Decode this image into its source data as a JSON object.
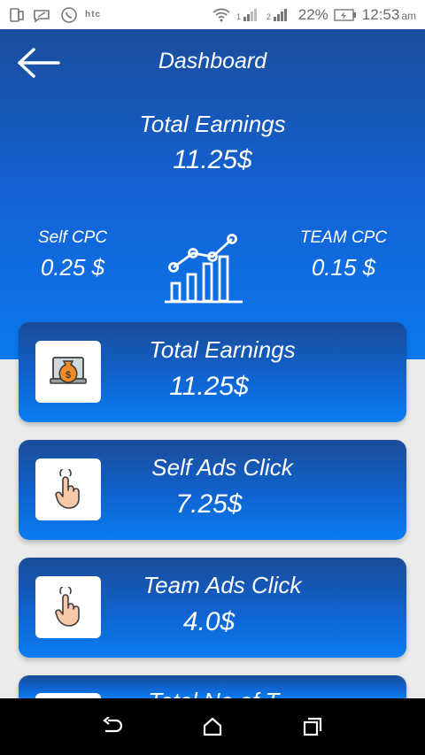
{
  "status_bar": {
    "carrier": "htc",
    "battery_percent": "22%",
    "time": "12:53",
    "time_suffix": "am"
  },
  "header": {
    "title": "Dashboard"
  },
  "summary": {
    "total_label": "Total Earnings",
    "total_value": "11.25$",
    "self_cpc_label": "Self CPC",
    "self_cpc_value": "0.25 $",
    "team_cpc_label": "TEAM CPC",
    "team_cpc_value": "0.15 $"
  },
  "cards": [
    {
      "label": "Total Earnings",
      "value": "11.25$",
      "icon": "money-bag-icon"
    },
    {
      "label": "Self Ads Click",
      "value": "7.25$",
      "icon": "tap-hand-icon"
    },
    {
      "label": "Team Ads Click",
      "value": "4.0$",
      "icon": "tap-hand-icon"
    },
    {
      "label": "Total No of T...",
      "icon": "blank-icon"
    }
  ],
  "colors": {
    "accent_dark": "#1b4a93",
    "accent_light": "#0a79ee",
    "background": "#ebebeb"
  }
}
